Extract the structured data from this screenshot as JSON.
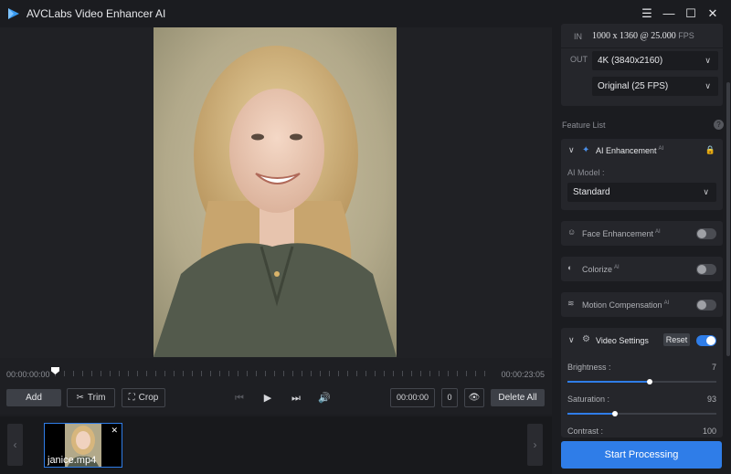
{
  "window": {
    "title": "AVCLabs Video Enhancer AI"
  },
  "timeline": {
    "current": "00:00:00:00",
    "total": "00:00:23:05",
    "position": 0.0
  },
  "controls": {
    "add_label": "Add",
    "trim_label": "Trim",
    "crop_label": "Crop",
    "time_field": "00:00:00",
    "counter": "0",
    "delete_all_label": "Delete All"
  },
  "clips": [
    {
      "name": "janice.mp4"
    }
  ],
  "panel": {
    "input": {
      "tag": "IN",
      "resolution": "1000 x 1360 @ 25.000",
      "unit": "FPS"
    },
    "output": {
      "tag": "OUT",
      "resolution": "4K (3840x2160)",
      "framerate": "Original (25 FPS)"
    },
    "feature_list_label": "Feature List",
    "ai_enhancement": {
      "label": "AI Enhancement",
      "badge": "AI",
      "model_label": "AI Model :",
      "model_value": "Standard"
    },
    "face_enhancement": {
      "label": "Face Enhancement",
      "badge": "AI",
      "enabled": false
    },
    "colorize": {
      "label": "Colorize",
      "badge": "AI",
      "enabled": false
    },
    "motion_compensation": {
      "label": "Motion Compensation",
      "badge": "AI",
      "enabled": false
    },
    "video_settings": {
      "label": "Video Settings",
      "reset_label": "Reset",
      "enabled": true,
      "brightness": {
        "label": "Brightness :",
        "value": "7",
        "level": 0.55
      },
      "saturation": {
        "label": "Saturation :",
        "value": "93",
        "level": 0.32
      },
      "contrast": {
        "label": "Contrast :",
        "value": "100"
      }
    },
    "start_label": "Start Processing"
  },
  "colors": {
    "accent": "#2f7de8",
    "background": "#1c1d21",
    "panel": "#25262b"
  }
}
